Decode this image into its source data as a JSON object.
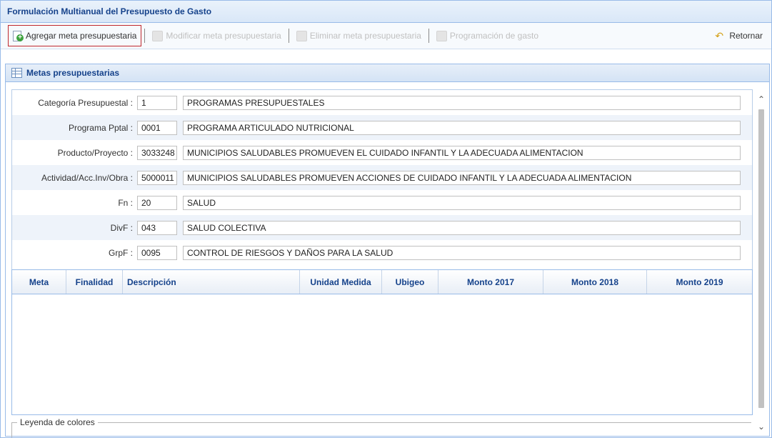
{
  "window": {
    "title": "Formulación Multianual del Presupuesto de Gasto"
  },
  "toolbar": {
    "add_label": "Agregar meta presupuestaria",
    "modify_label": "Modificar meta presupuestaria",
    "delete_label": "Eliminar meta presupuestaria",
    "schedule_label": "Programación de gasto",
    "return_label": "Retornar"
  },
  "panel": {
    "title": "Metas presupuestarias"
  },
  "form": {
    "rows": [
      {
        "label": "Categoría Presupuestal :",
        "code": "1",
        "desc": "PROGRAMAS PRESUPUESTALES"
      },
      {
        "label": "Programa Pptal :",
        "code": "0001",
        "desc": "PROGRAMA ARTICULADO NUTRICIONAL"
      },
      {
        "label": "Producto/Proyecto :",
        "code": "3033248",
        "desc": "MUNICIPIOS SALUDABLES PROMUEVEN EL CUIDADO INFANTIL Y LA ADECUADA ALIMENTACION"
      },
      {
        "label": "Actividad/Acc.Inv/Obra :",
        "code": "5000011",
        "desc": "MUNICIPIOS SALUDABLES PROMUEVEN ACCIONES DE CUIDADO INFANTIL Y LA ADECUADA ALIMENTACION"
      },
      {
        "label": "Fn :",
        "code": "20",
        "desc": "SALUD"
      },
      {
        "label": "DivF :",
        "code": "043",
        "desc": "SALUD COLECTIVA"
      },
      {
        "label": "GrpF :",
        "code": "0095",
        "desc": "CONTROL DE RIESGOS Y DAÑOS PARA LA SALUD"
      }
    ]
  },
  "grid": {
    "columns": [
      "Meta",
      "Finalidad",
      "Descripción",
      "Unidad Medida",
      "Ubigeo",
      "Monto 2017",
      "Monto 2018",
      "Monto 2019"
    ]
  },
  "legend": {
    "title": "Leyenda de colores"
  },
  "colors": {
    "highlight_border": "#c0282e",
    "header_text": "#15428b",
    "panel_border": "#99bbe8"
  }
}
